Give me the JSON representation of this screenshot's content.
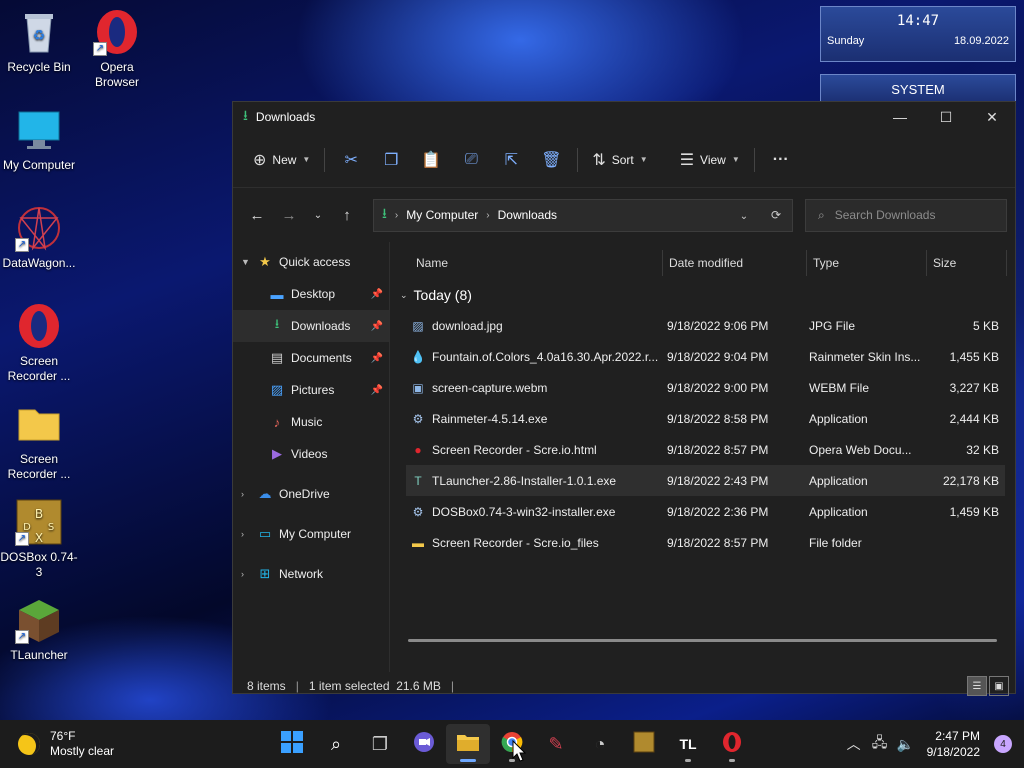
{
  "desktop": {
    "icons": [
      {
        "label": "Recycle Bin",
        "icon": "recycle-bin-icon"
      },
      {
        "label": "Opera Browser",
        "icon": "opera-icon"
      },
      {
        "label": "My Computer",
        "icon": "monitor-icon"
      },
      {
        "label": "DataWagon...",
        "icon": "datawagon-icon"
      },
      {
        "label": "Screen Recorder ...",
        "icon": "opera-icon"
      },
      {
        "label": "Screen Recorder ...",
        "icon": "folder-icon"
      },
      {
        "label": "DOSBox 0.74-3",
        "icon": "dosbox-icon"
      },
      {
        "label": "TLauncher",
        "icon": "grass-block-icon"
      }
    ]
  },
  "widgets": {
    "time": "14:47",
    "day": "Sunday",
    "date": "18.09.2022",
    "system_label": "SYSTEM"
  },
  "window": {
    "title": "Downloads",
    "commands": {
      "new_label": "New",
      "sort_label": "Sort",
      "view_label": "View"
    },
    "address": {
      "crumbs": [
        "My Computer",
        "Downloads"
      ]
    },
    "search_placeholder": "Search Downloads",
    "nav": {
      "quick_access": "Quick access",
      "items": [
        {
          "label": "Desktop",
          "icon": "desktop-icon",
          "color": "#4aa3ff"
        },
        {
          "label": "Downloads",
          "icon": "download-icon",
          "color": "#3ec27a"
        },
        {
          "label": "Documents",
          "icon": "document-icon",
          "color": "#cfcfcf"
        },
        {
          "label": "Pictures",
          "icon": "pictures-icon",
          "color": "#4aa3ff"
        },
        {
          "label": "Music",
          "icon": "music-icon",
          "color": "#e8675c"
        },
        {
          "label": "Videos",
          "icon": "videos-icon",
          "color": "#9b6ae0"
        }
      ],
      "onedrive": "OneDrive",
      "my_computer": "My Computer",
      "network": "Network"
    },
    "columns": {
      "name": "Name",
      "date": "Date modified",
      "type": "Type",
      "size": "Size"
    },
    "group_label": "Today (8)",
    "files": [
      {
        "name": "download.jpg",
        "date": "9/18/2022 9:06 PM",
        "type": "JPG File",
        "size": "5 KB",
        "icon": "image-file-icon",
        "color": "#8fb8e8"
      },
      {
        "name": "Fountain.of.Colors_4.0a16.30.Apr.2022.r...",
        "date": "9/18/2022 9:04 PM",
        "type": "Rainmeter Skin Ins...",
        "size": "1,455 KB",
        "icon": "rainmeter-drop-icon",
        "color": "#7cc35a"
      },
      {
        "name": "screen-capture.webm",
        "date": "9/18/2022 9:00 PM",
        "type": "WEBM File",
        "size": "3,227 KB",
        "icon": "video-file-icon",
        "color": "#8fb8e8"
      },
      {
        "name": "Rainmeter-4.5.14.exe",
        "date": "9/18/2022 8:58 PM",
        "type": "Application",
        "size": "2,444 KB",
        "icon": "installer-icon",
        "color": "#a8c8f0"
      },
      {
        "name": "Screen Recorder - Scre.io.html",
        "date": "9/18/2022 8:57 PM",
        "type": "Opera Web Docu...",
        "size": "32 KB",
        "icon": "opera-icon",
        "color": "#e0262e"
      },
      {
        "name": "TLauncher-2.86-Installer-1.0.1.exe",
        "date": "9/18/2022 2:43 PM",
        "type": "Application",
        "size": "22,178 KB",
        "icon": "tlauncher-icon",
        "color": "#7fd0c0"
      },
      {
        "name": "DOSBox0.74-3-win32-installer.exe",
        "date": "9/18/2022 2:36 PM",
        "type": "Application",
        "size": "1,459 KB",
        "icon": "installer-icon",
        "color": "#a8c8f0"
      },
      {
        "name": "Screen Recorder - Scre.io_files",
        "date": "9/18/2022 8:57 PM",
        "type": "File folder",
        "size": "",
        "icon": "folder-icon",
        "color": "#f3c84a"
      }
    ],
    "status": {
      "count": "8 items",
      "selection": "1 item selected  21.6 MB"
    }
  },
  "taskbar": {
    "weather_temp": "76°F",
    "weather_desc": "Mostly clear",
    "time": "2:47 PM",
    "date": "9/18/2022",
    "notifications": "4"
  }
}
